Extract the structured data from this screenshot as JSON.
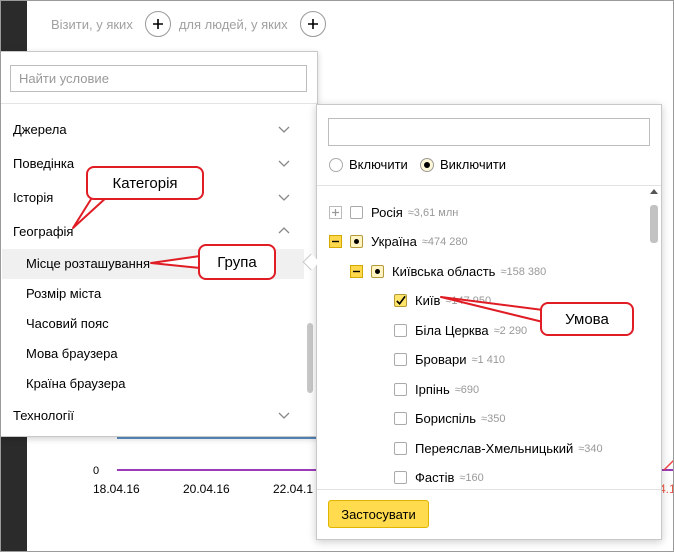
{
  "topbar": {
    "visits_label": "Візити, у яких",
    "people_label": "для людей, у яких"
  },
  "chart": {
    "zero_label": "0",
    "dates": [
      "18.04.16",
      "20.04.16",
      "22.04.1"
    ],
    "right_date": "4.1"
  },
  "left_panel": {
    "search_placeholder": "Найти условие",
    "categories": {
      "sources": "Джерела",
      "behavior": "Поведінка",
      "history": "Історія",
      "geography": "Географія",
      "technologies": "Технології"
    },
    "geography_items": [
      "Місце розташування",
      "Розмір міста",
      "Часовий пояс",
      "Мова браузера",
      "Країна браузера"
    ]
  },
  "right_panel": {
    "search_value": "",
    "radio_exclude": "Включити",
    "radio_include": "Виключити",
    "tree": [
      {
        "name": "Росія",
        "count": "≈3,61 млн"
      },
      {
        "name": "Україна",
        "count": "≈474 280"
      },
      {
        "name": "Київська область",
        "count": "≈158 380"
      },
      {
        "name": "Київ",
        "count": "≈147 950"
      },
      {
        "name": "Біла Церква",
        "count": "≈2 290"
      },
      {
        "name": "Бровари",
        "count": "≈1 410"
      },
      {
        "name": "Ірпінь",
        "count": "≈690"
      },
      {
        "name": "Бориспіль",
        "count": "≈350"
      },
      {
        "name": "Переяслав-Хмельницький",
        "count": "≈340"
      },
      {
        "name": "Фастів",
        "count": "≈160"
      }
    ],
    "apply_label": "Застосувати"
  },
  "callouts": {
    "category": "Категорія",
    "group": "Група",
    "condition": "Умова"
  },
  "colors": {
    "accent": "#ffdb4d",
    "callout": "#e01c24"
  }
}
